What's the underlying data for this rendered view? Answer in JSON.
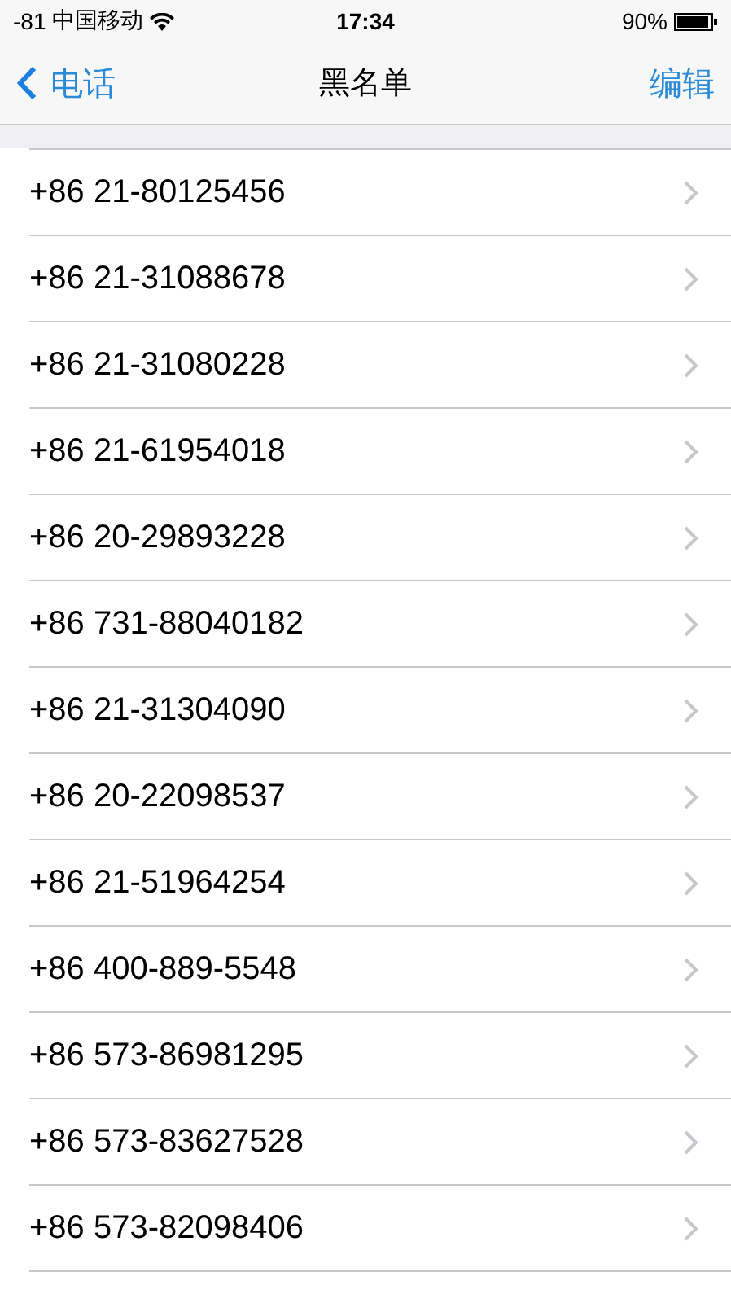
{
  "status_bar": {
    "signal": "-81",
    "carrier": "中国移动",
    "time": "17:34",
    "battery": "90%"
  },
  "nav_bar": {
    "back": "电话",
    "title": "黑名单",
    "action": "编辑"
  },
  "numbers": [
    "+86 21-80125456",
    "+86 21-31088678",
    "+86 21-31080228",
    "+86 21-61954018",
    "+86 20-29893228",
    "+86 731-88040182",
    "+86 21-31304090",
    "+86 20-22098537",
    "+86 21-51964254",
    "+86 400-889-5548",
    "+86 573-86981295",
    "+86 573-83627528",
    "+86 573-82098406"
  ]
}
